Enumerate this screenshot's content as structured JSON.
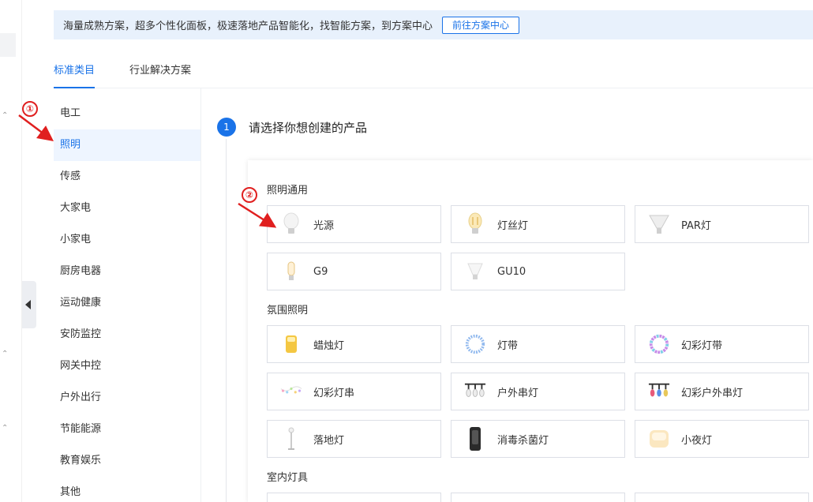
{
  "banner": {
    "text": "海量成熟方案，超多个性化面板，极速落地产品智能化，找智能方案，到方案中心",
    "button": "前往方案中心"
  },
  "tabs": [
    {
      "label": "标准类目",
      "active": true
    },
    {
      "label": "行业解决方案",
      "active": false
    }
  ],
  "categories": [
    {
      "label": "电工"
    },
    {
      "label": "照明",
      "active": true
    },
    {
      "label": "传感"
    },
    {
      "label": "大家电"
    },
    {
      "label": "小家电"
    },
    {
      "label": "厨房电器"
    },
    {
      "label": "运动健康"
    },
    {
      "label": "安防监控"
    },
    {
      "label": "网关中控"
    },
    {
      "label": "户外出行"
    },
    {
      "label": "节能能源"
    },
    {
      "label": "教育娱乐"
    },
    {
      "label": "其他"
    }
  ],
  "step": {
    "number": "1",
    "title": "请选择你想创建的产品"
  },
  "sections": [
    {
      "title": "照明通用",
      "items": [
        "光源",
        "灯丝灯",
        "PAR灯",
        "G9",
        "GU10"
      ]
    },
    {
      "title": "氛围照明",
      "items": [
        "蜡烛灯",
        "灯带",
        "幻彩灯带",
        "幻彩灯串",
        "户外串灯",
        "幻彩户外串灯",
        "落地灯",
        "消毒杀菌灯",
        "小夜灯"
      ]
    },
    {
      "title": "室内灯具",
      "items": []
    }
  ],
  "annotations": [
    "①",
    "②"
  ],
  "icons": [
    "bulb-icon",
    "filament-bulb-icon",
    "par-lamp-icon",
    "g9-bulb-icon",
    "gu10-bulb-icon",
    "candle-icon",
    "light-strip-icon",
    "rgb-light-strip-icon",
    "string-lights-icon",
    "outdoor-string-lights-icon",
    "rgb-outdoor-string-lights-icon",
    "floor-lamp-icon",
    "uv-lamp-icon",
    "night-light-icon"
  ],
  "colors": {
    "accent": "#1a73e8",
    "annotation": "#e01f1f",
    "banner_bg": "#e8f1fc",
    "active_bg": "#eef5ff"
  }
}
